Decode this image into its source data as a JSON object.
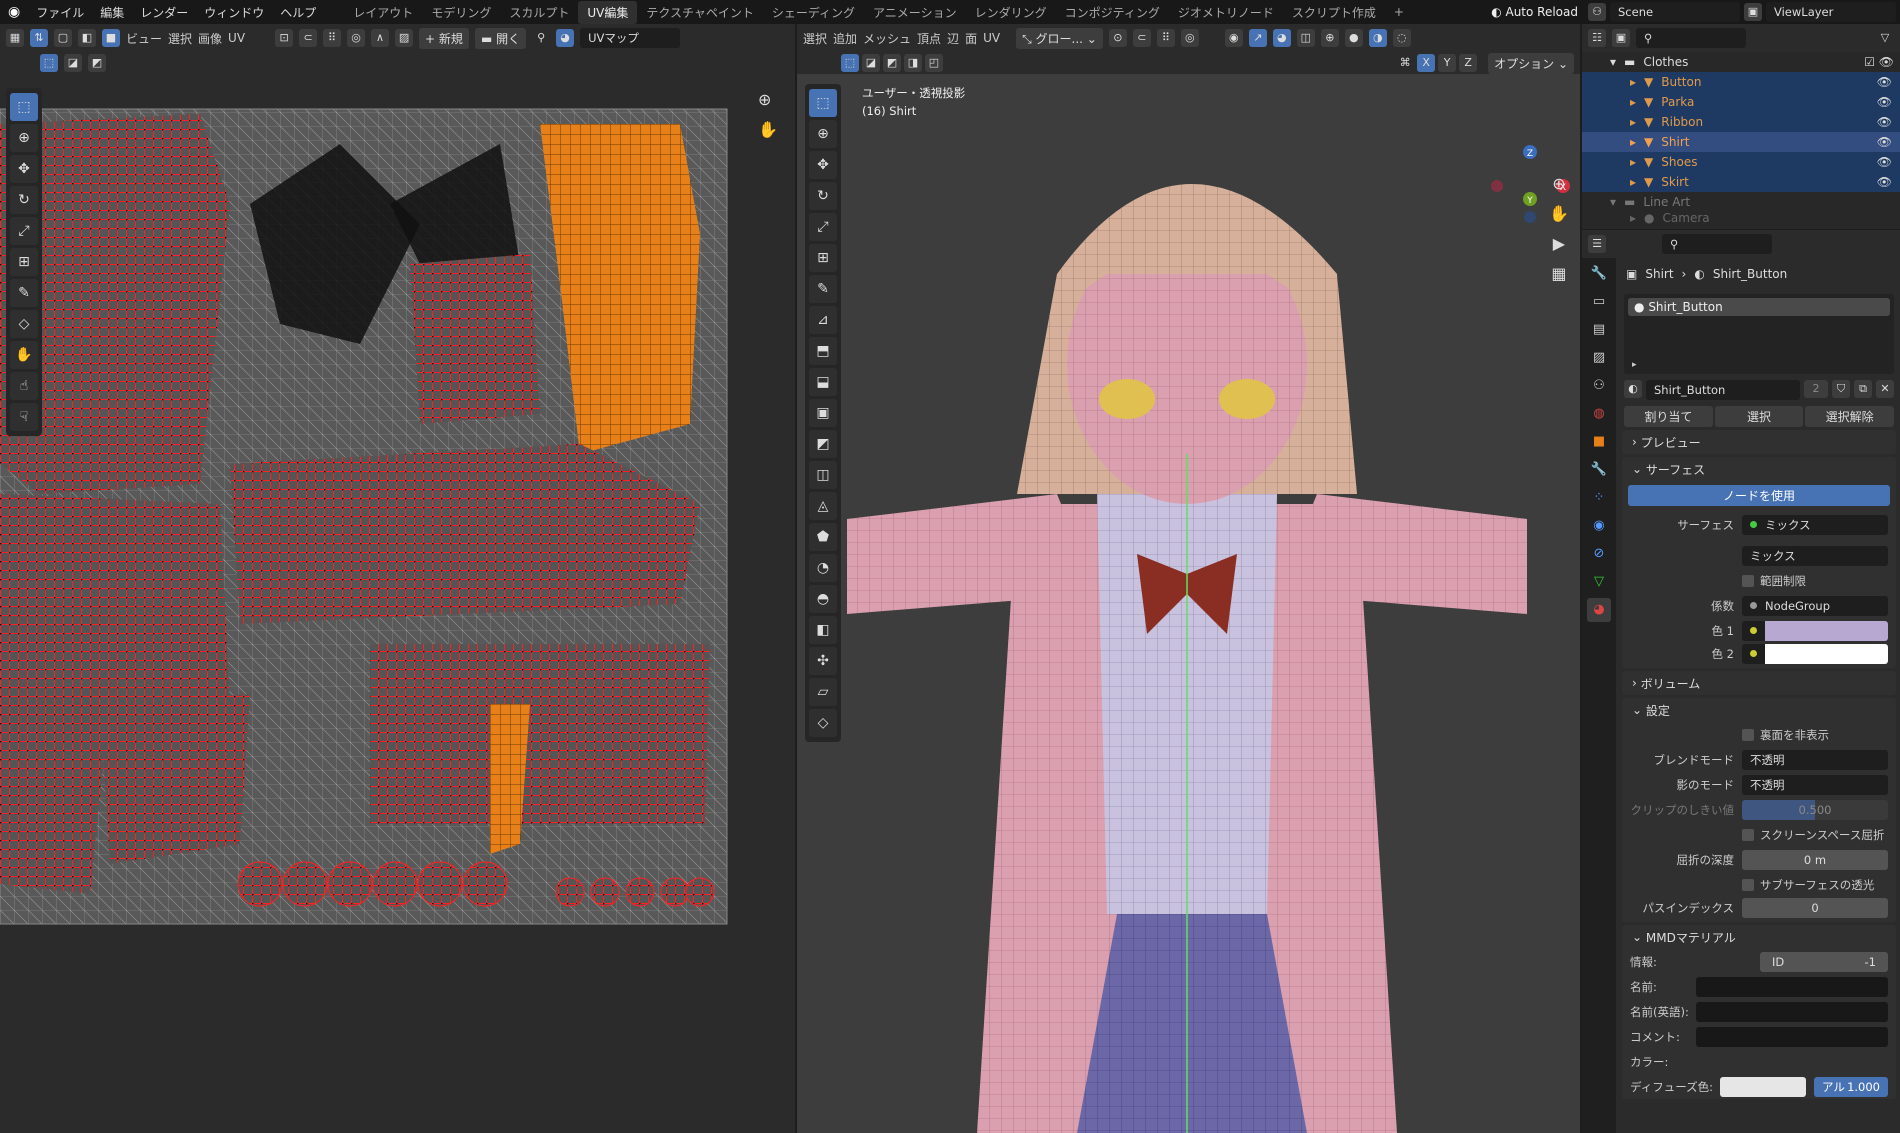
{
  "topbar": {
    "menus": [
      "ファイル",
      "編集",
      "レンダー",
      "ウィンドウ",
      "ヘルプ"
    ],
    "workspaces": [
      "レイアウト",
      "モデリング",
      "スカルプト",
      "UV編集",
      "テクスチャペイント",
      "シェーディング",
      "アニメーション",
      "レンダリング",
      "コンポジティング",
      "ジオメトリノード",
      "スクリプト作成"
    ],
    "active_workspace": "UV編集",
    "add_tab": "+",
    "auto_reload": "Auto Reload",
    "scene": "Scene",
    "view_layer": "ViewLayer"
  },
  "uv_editor": {
    "menus": [
      "ビュー",
      "選択",
      "画像",
      "UV"
    ],
    "new_label": "新規",
    "open_label": "開く",
    "uv_map": "UVマップ",
    "mesh_color": "#ff2020",
    "selected_color": "#e8801a"
  },
  "viewport": {
    "menus": [
      "選択",
      "追加",
      "メッシュ",
      "頂点",
      "辺",
      "面",
      "UV"
    ],
    "orientation": "グロー...",
    "axes": [
      "X",
      "Y",
      "Z"
    ],
    "options": "オプション",
    "view_name": "ユーザー・透視投影",
    "object_info": "(16) Shirt",
    "gizmo": {
      "z": "Z",
      "x": "X",
      "y": "Y"
    }
  },
  "outliner": {
    "collections": [
      {
        "name": "Clothes",
        "items": [
          "Button",
          "Parka",
          "Ribbon",
          "Shirt",
          "Shoes",
          "Skirt"
        ],
        "active": "Shirt"
      },
      {
        "name": "Line Art",
        "items": [
          "Camera"
        ]
      }
    ]
  },
  "properties": {
    "breadcrumb": {
      "object": "Shirt",
      "material": "Shirt_Button"
    },
    "slots": [
      "Shirt_Button"
    ],
    "material_name": "Shirt_Button",
    "users": "2",
    "assign": "割り当て",
    "select": "選択",
    "deselect": "選択解除",
    "preview": "プレビュー",
    "surface_panel": "サーフェス",
    "use_nodes": "ノードを使用",
    "surface_label": "サーフェス",
    "surface_value": "ミックス",
    "mix_mode": "ミックス",
    "clamp": "範囲制限",
    "factor_label": "係数",
    "factor_value": "NodeGroup",
    "color1_label": "色 1",
    "color1": "#b6a8d0",
    "color2_label": "色 2",
    "color2": "#ffffff",
    "volume": "ボリューム",
    "settings": "設定",
    "backface": "裏面を非表示",
    "blend_label": "ブレンドモード",
    "blend_value": "不透明",
    "shadow_label": "影のモード",
    "shadow_value": "不透明",
    "clip_label": "クリップのしきい値",
    "clip_value": "0.500",
    "clip_fraction": 0.5,
    "ssr": "スクリーンスペース屈折",
    "refr_label": "屈折の深度",
    "refr_value": "0 m",
    "sss": "サブサーフェスの透光",
    "pass_label": "パスインデックス",
    "pass_value": "0",
    "mmd": "MMDマテリアル",
    "info_label": "情報:",
    "id_label": "ID",
    "id_value": "-1",
    "name_label": "名前:",
    "name_en_label": "名前(英語):",
    "comment_label": "コメント:",
    "color_label": "カラー:",
    "diffuse_label": "ディフューズ色:",
    "alpha_label": "アル",
    "alpha_value": "1.000"
  }
}
